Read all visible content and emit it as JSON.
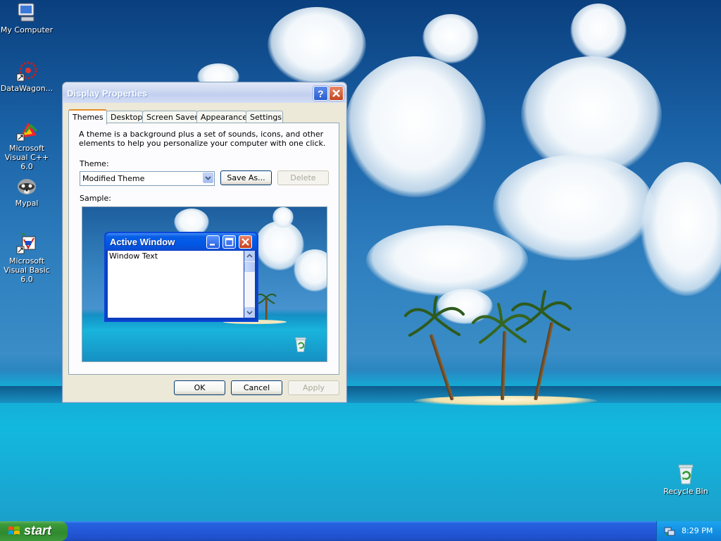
{
  "desktop": {
    "icons": [
      {
        "label": "My Computer",
        "icon": "computer-icon"
      },
      {
        "label": "DataWagon...",
        "icon": "datawagon-icon"
      },
      {
        "label": "Microsoft Visual C++ 6.0",
        "icon": "visual-cpp-icon"
      },
      {
        "label": "Mypal",
        "icon": "mypal-raccoon-icon"
      },
      {
        "label": "Microsoft Visual Basic 6.0",
        "icon": "visual-basic-icon"
      },
      {
        "label": "Recycle Bin",
        "icon": "recycle-bin-icon"
      }
    ]
  },
  "dialog": {
    "title": "Display Properties",
    "tabs": [
      "Themes",
      "Desktop",
      "Screen Saver",
      "Appearance",
      "Settings"
    ],
    "active_tab": "Themes",
    "description": "A theme is a background plus a set of sounds, icons, and other elements to help you personalize your computer with one click.",
    "theme_label": "Theme:",
    "theme_value": "Modified Theme",
    "save_as_label": "Save As...",
    "delete_label": "Delete",
    "sample_label": "Sample:",
    "sample": {
      "window_title": "Active Window",
      "window_text": "Window Text"
    },
    "ok_label": "OK",
    "cancel_label": "Cancel",
    "apply_label": "Apply"
  },
  "taskbar": {
    "start_label": "start",
    "clock": "8:29 PM"
  },
  "colors": {
    "taskbar_blue": "#2358d9",
    "start_green": "#3c9a3a",
    "tray_blue": "#1290e3",
    "dialog_face": "#ece9d8",
    "active_tab_accent": "#e68b2c"
  }
}
